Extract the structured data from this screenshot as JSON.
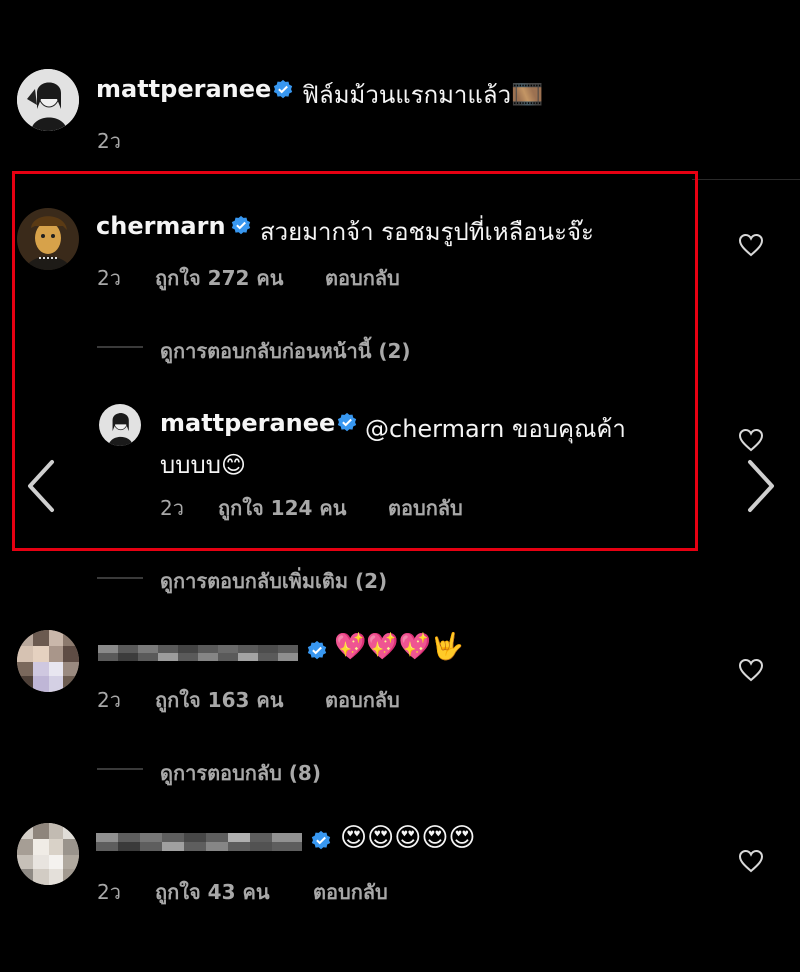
{
  "post": {
    "username": "mattperanee",
    "caption": "ฟิล์มม้วนแรกมาแล้ว",
    "caption_emoji": "🎞️",
    "time": "2ว"
  },
  "comments": [
    {
      "username": "chermarn",
      "text": "สวยมากจ้า รอชมรูปที่เหลือนะจ๊ะ",
      "time": "2ว",
      "likes": "ถูกใจ 272 คน",
      "reply": "ตอบกลับ",
      "view_previous": "ดูการตอบกลับก่อนหน้านี้ (2)",
      "nested_reply": {
        "username": "mattperanee",
        "text_line1": "@chermarn ขอบคุณค้า",
        "text_line2": "บบบบ😊",
        "time": "2ว",
        "likes": "ถูกใจ 124 คน",
        "reply": "ตอบกลับ"
      },
      "view_more": "ดูการตอบกลับเพิ่มเติม (2)"
    },
    {
      "username": "",
      "text": "💖💖💖🤟",
      "time": "2ว",
      "likes": "ถูกใจ 163 คน",
      "reply": "ตอบกลับ",
      "view_replies": "ดูการตอบกลับ (8)"
    },
    {
      "username": "",
      "text": "😍😍😍😍😍",
      "time": "2ว",
      "likes": "ถูกใจ 43 คน",
      "reply": "ตอบกลับ"
    }
  ],
  "colors": {
    "background": "#000000",
    "text": "#f5f5f5",
    "secondary": "#a8a8a8",
    "verified": "#3897f0",
    "highlight_box": "#e60012"
  },
  "icons": [
    "verified-icon",
    "heart-icon",
    "chevron-left-icon",
    "chevron-right-icon"
  ]
}
